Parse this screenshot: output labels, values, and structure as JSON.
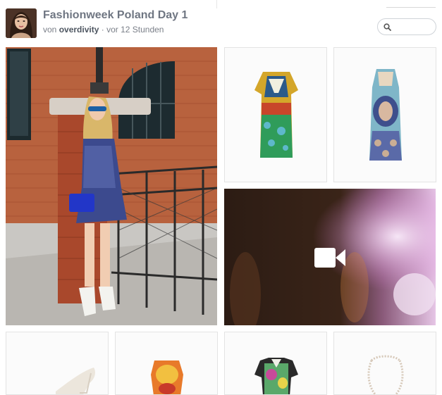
{
  "header": {
    "title": "Fashionweek Poland Day 1",
    "by_prefix": "von",
    "author": "overdivity",
    "time": "· vor 12 Stunden"
  },
  "search": {
    "placeholder": ""
  },
  "tiles": {
    "main_photo": {
      "icon": "photo"
    },
    "dress_1": {
      "icon": "dress-image"
    },
    "dress_2": {
      "icon": "dress-image"
    },
    "video": {
      "icon": "video-camera-icon"
    },
    "shoe": {
      "icon": "shoe-image"
    },
    "dress_3": {
      "icon": "dress-image"
    },
    "dress_4": {
      "icon": "dress-image"
    },
    "necklace": {
      "icon": "necklace-image"
    }
  },
  "colors": {
    "title": "#6f7682",
    "author": "#4d5560",
    "border": "#e3e3e3"
  }
}
